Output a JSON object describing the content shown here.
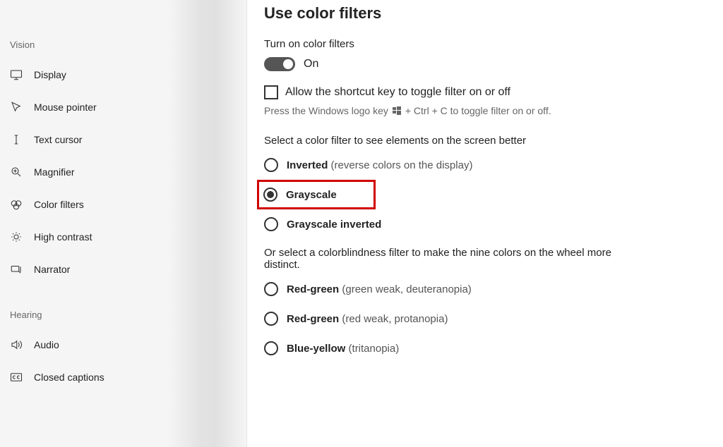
{
  "sidebar": {
    "sections": {
      "vision": {
        "header": "Vision",
        "items": [
          {
            "label": "Display",
            "icon": "display-icon"
          },
          {
            "label": "Mouse pointer",
            "icon": "mouse-pointer-icon"
          },
          {
            "label": "Text cursor",
            "icon": "text-cursor-icon"
          },
          {
            "label": "Magnifier",
            "icon": "magnifier-icon"
          },
          {
            "label": "Color filters",
            "icon": "color-filters-icon"
          },
          {
            "label": "High contrast",
            "icon": "high-contrast-icon"
          },
          {
            "label": "Narrator",
            "icon": "narrator-icon"
          }
        ]
      },
      "hearing": {
        "header": "Hearing",
        "items": [
          {
            "label": "Audio",
            "icon": "audio-icon"
          },
          {
            "label": "Closed captions",
            "icon": "closed-captions-icon"
          }
        ]
      }
    }
  },
  "main": {
    "title": "Use color filters",
    "toggle_label": "Turn on color filters",
    "toggle_state": "On",
    "checkbox_label": "Allow the shortcut key to toggle filter on or off",
    "hint_prefix": "Press the Windows logo key",
    "hint_suffix": "+ Ctrl + C to toggle filter on or off.",
    "select_desc": "Select a color filter to see elements on the screen better",
    "radios_a": [
      {
        "bold": "Inverted",
        "sub": " (reverse colors on the display)",
        "selected": false,
        "highlighted": false
      },
      {
        "bold": "Grayscale",
        "sub": "",
        "selected": true,
        "highlighted": true
      },
      {
        "bold": "Grayscale inverted",
        "sub": "",
        "selected": false,
        "highlighted": false
      }
    ],
    "colorblind_desc": "Or select a colorblindness filter to make the nine colors on the wheel more distinct.",
    "radios_b": [
      {
        "bold": "Red-green",
        "sub": " (green weak, deuteranopia)",
        "selected": false
      },
      {
        "bold": "Red-green",
        "sub": " (red weak, protanopia)",
        "selected": false
      },
      {
        "bold": "Blue-yellow",
        "sub": " (tritanopia)",
        "selected": false
      }
    ]
  }
}
